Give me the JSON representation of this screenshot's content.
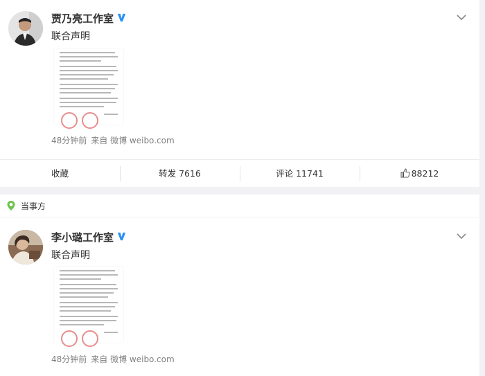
{
  "posts": [
    {
      "author": "贾乃亮工作室",
      "text": "联合声明",
      "time": "48分钟前",
      "source": "来自 微博 weibo.com",
      "actions": {
        "favorite": "收藏",
        "repost": "转发 7616",
        "comment": "评论 11741",
        "like": "88212"
      }
    },
    {
      "author": "李小璐工作室",
      "text": "联合声明",
      "time": "48分钟前",
      "source": "来自 微博 weibo.com"
    }
  ],
  "section_label": "当事方",
  "colors": {
    "verified_badge": "#2b8ff5",
    "party_icon": "#6cc24a",
    "seal": "#e88c8c"
  },
  "icons": [
    "verified-badge-icon",
    "chevron-down-icon",
    "thumbs-up-icon",
    "location-pin-icon"
  ]
}
